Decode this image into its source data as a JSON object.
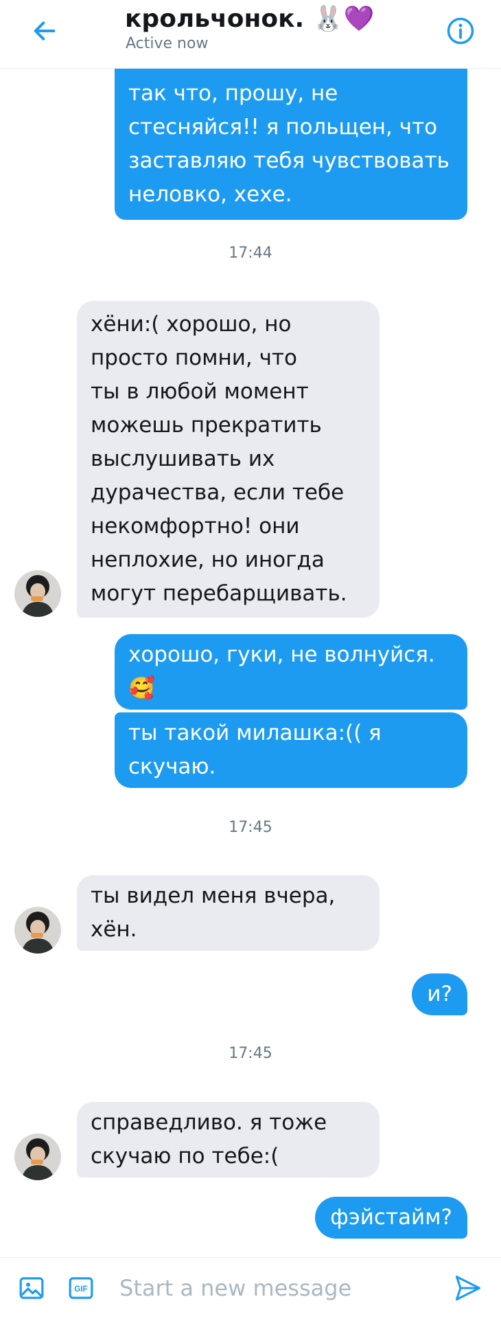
{
  "header": {
    "title": "крольчонок. 🐰💜",
    "status": "Active now"
  },
  "messages": [
    {
      "direction": "out",
      "text": "так что, прошу, не\nстесняйся!! я польщен, что\nзаставляю тебя чувствовать\nнеловко, хехе."
    },
    {
      "timestamp": "17:44"
    },
    {
      "direction": "in",
      "text": "хёни:( хорошо, но\nпросто помни, что\nты в любой момент\nможешь прекратить\nвыслушивать их\nдурачества, если тебе\nнекомфортно! они\nнеплохие, но иногда\nмогут перебарщивать."
    },
    {
      "direction": "out",
      "text": "хорошо, гуки, не волнуйся.\n🥰"
    },
    {
      "direction": "out",
      "text": "ты такой милашка:(( я\nскучаю."
    },
    {
      "timestamp": "17:45"
    },
    {
      "direction": "in",
      "text": "ты видел меня вчера,\nхён."
    },
    {
      "direction": "out",
      "text": "и?"
    },
    {
      "timestamp": "17:45"
    },
    {
      "direction": "in",
      "text": "справедливо. я тоже\nскучаю по тебе:("
    },
    {
      "direction": "out",
      "text": "фэйстайм?"
    }
  ],
  "composer": {
    "placeholder": "Start a new message",
    "gif_label": "GIF"
  },
  "icons": {
    "back": "back-arrow-icon",
    "info": "info-icon",
    "image": "image-icon",
    "gif": "gif-icon",
    "send": "send-icon"
  },
  "colors": {
    "accent": "#1d9bf0",
    "incoming_bubble": "#e9ebf1",
    "text_secondary": "#657786"
  }
}
